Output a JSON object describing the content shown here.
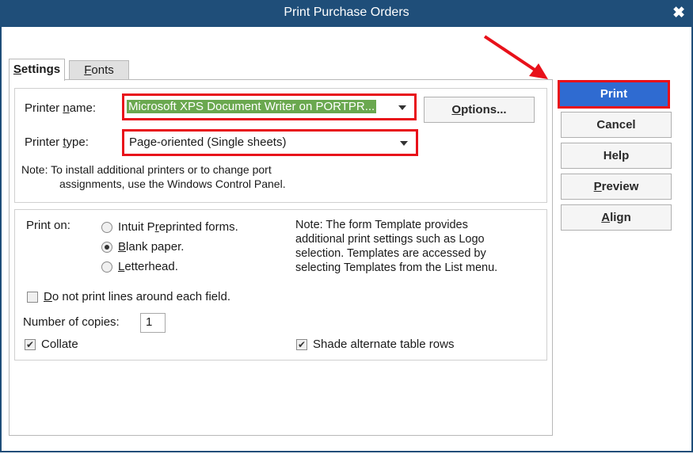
{
  "window": {
    "title": "Print Purchase Orders",
    "close_glyph": "✖"
  },
  "tabs": [
    {
      "label": "Settings",
      "mnemonic": "S",
      "rest": "ettings",
      "active": true
    },
    {
      "label": "Fonts",
      "mnemonic": "F",
      "rest": "onts",
      "active": false
    }
  ],
  "printer": {
    "name_label_pre": "Printer ",
    "name_label_mn": "n",
    "name_label_post": "ame:",
    "name_value": "Microsoft XPS Document Writer on PORTPR...",
    "type_label_pre": "Printer ",
    "type_label_mn": "t",
    "type_label_post": "ype:",
    "type_value": "Page-oriented (Single sheets)",
    "options_mn": "O",
    "options_rest": "ptions...",
    "note_line1": "Note: To install additional printers or to change port",
    "note_line2": "assignments, use the Windows Control Panel."
  },
  "print_on": {
    "label": "Print on:",
    "options": [
      {
        "pre": "Intuit P",
        "mn": "r",
        "post": "eprinted forms.",
        "selected": false
      },
      {
        "pre": "",
        "mn": "B",
        "post": "lank paper.",
        "selected": true
      },
      {
        "pre": "",
        "mn": "L",
        "post": "etterhead.",
        "selected": false
      }
    ],
    "note_lines": [
      "Note: The form Template provides",
      "additional print settings such as Logo",
      "selection.  Templates are accessed by",
      "selecting Templates from the List menu."
    ]
  },
  "options": {
    "no_lines_mn": "D",
    "no_lines_rest": "o not print lines around each field.",
    "no_lines_checked": false,
    "copies_label": "Number of copies:",
    "copies_value": "1",
    "collate_label": "Collate",
    "collate_checked": true,
    "shade_label": "Shade alternate table rows",
    "shade_checked": true
  },
  "buttons": {
    "print": "Print",
    "cancel": "Cancel",
    "help": "Help",
    "preview_mn": "P",
    "preview_rest": "review",
    "align_mn": "A",
    "align_rest": "lign"
  },
  "colors": {
    "titlebar": "#1f4e79",
    "highlight": "#e8111a",
    "print_button": "#2f6bd1",
    "selection": "#6aa84f"
  }
}
